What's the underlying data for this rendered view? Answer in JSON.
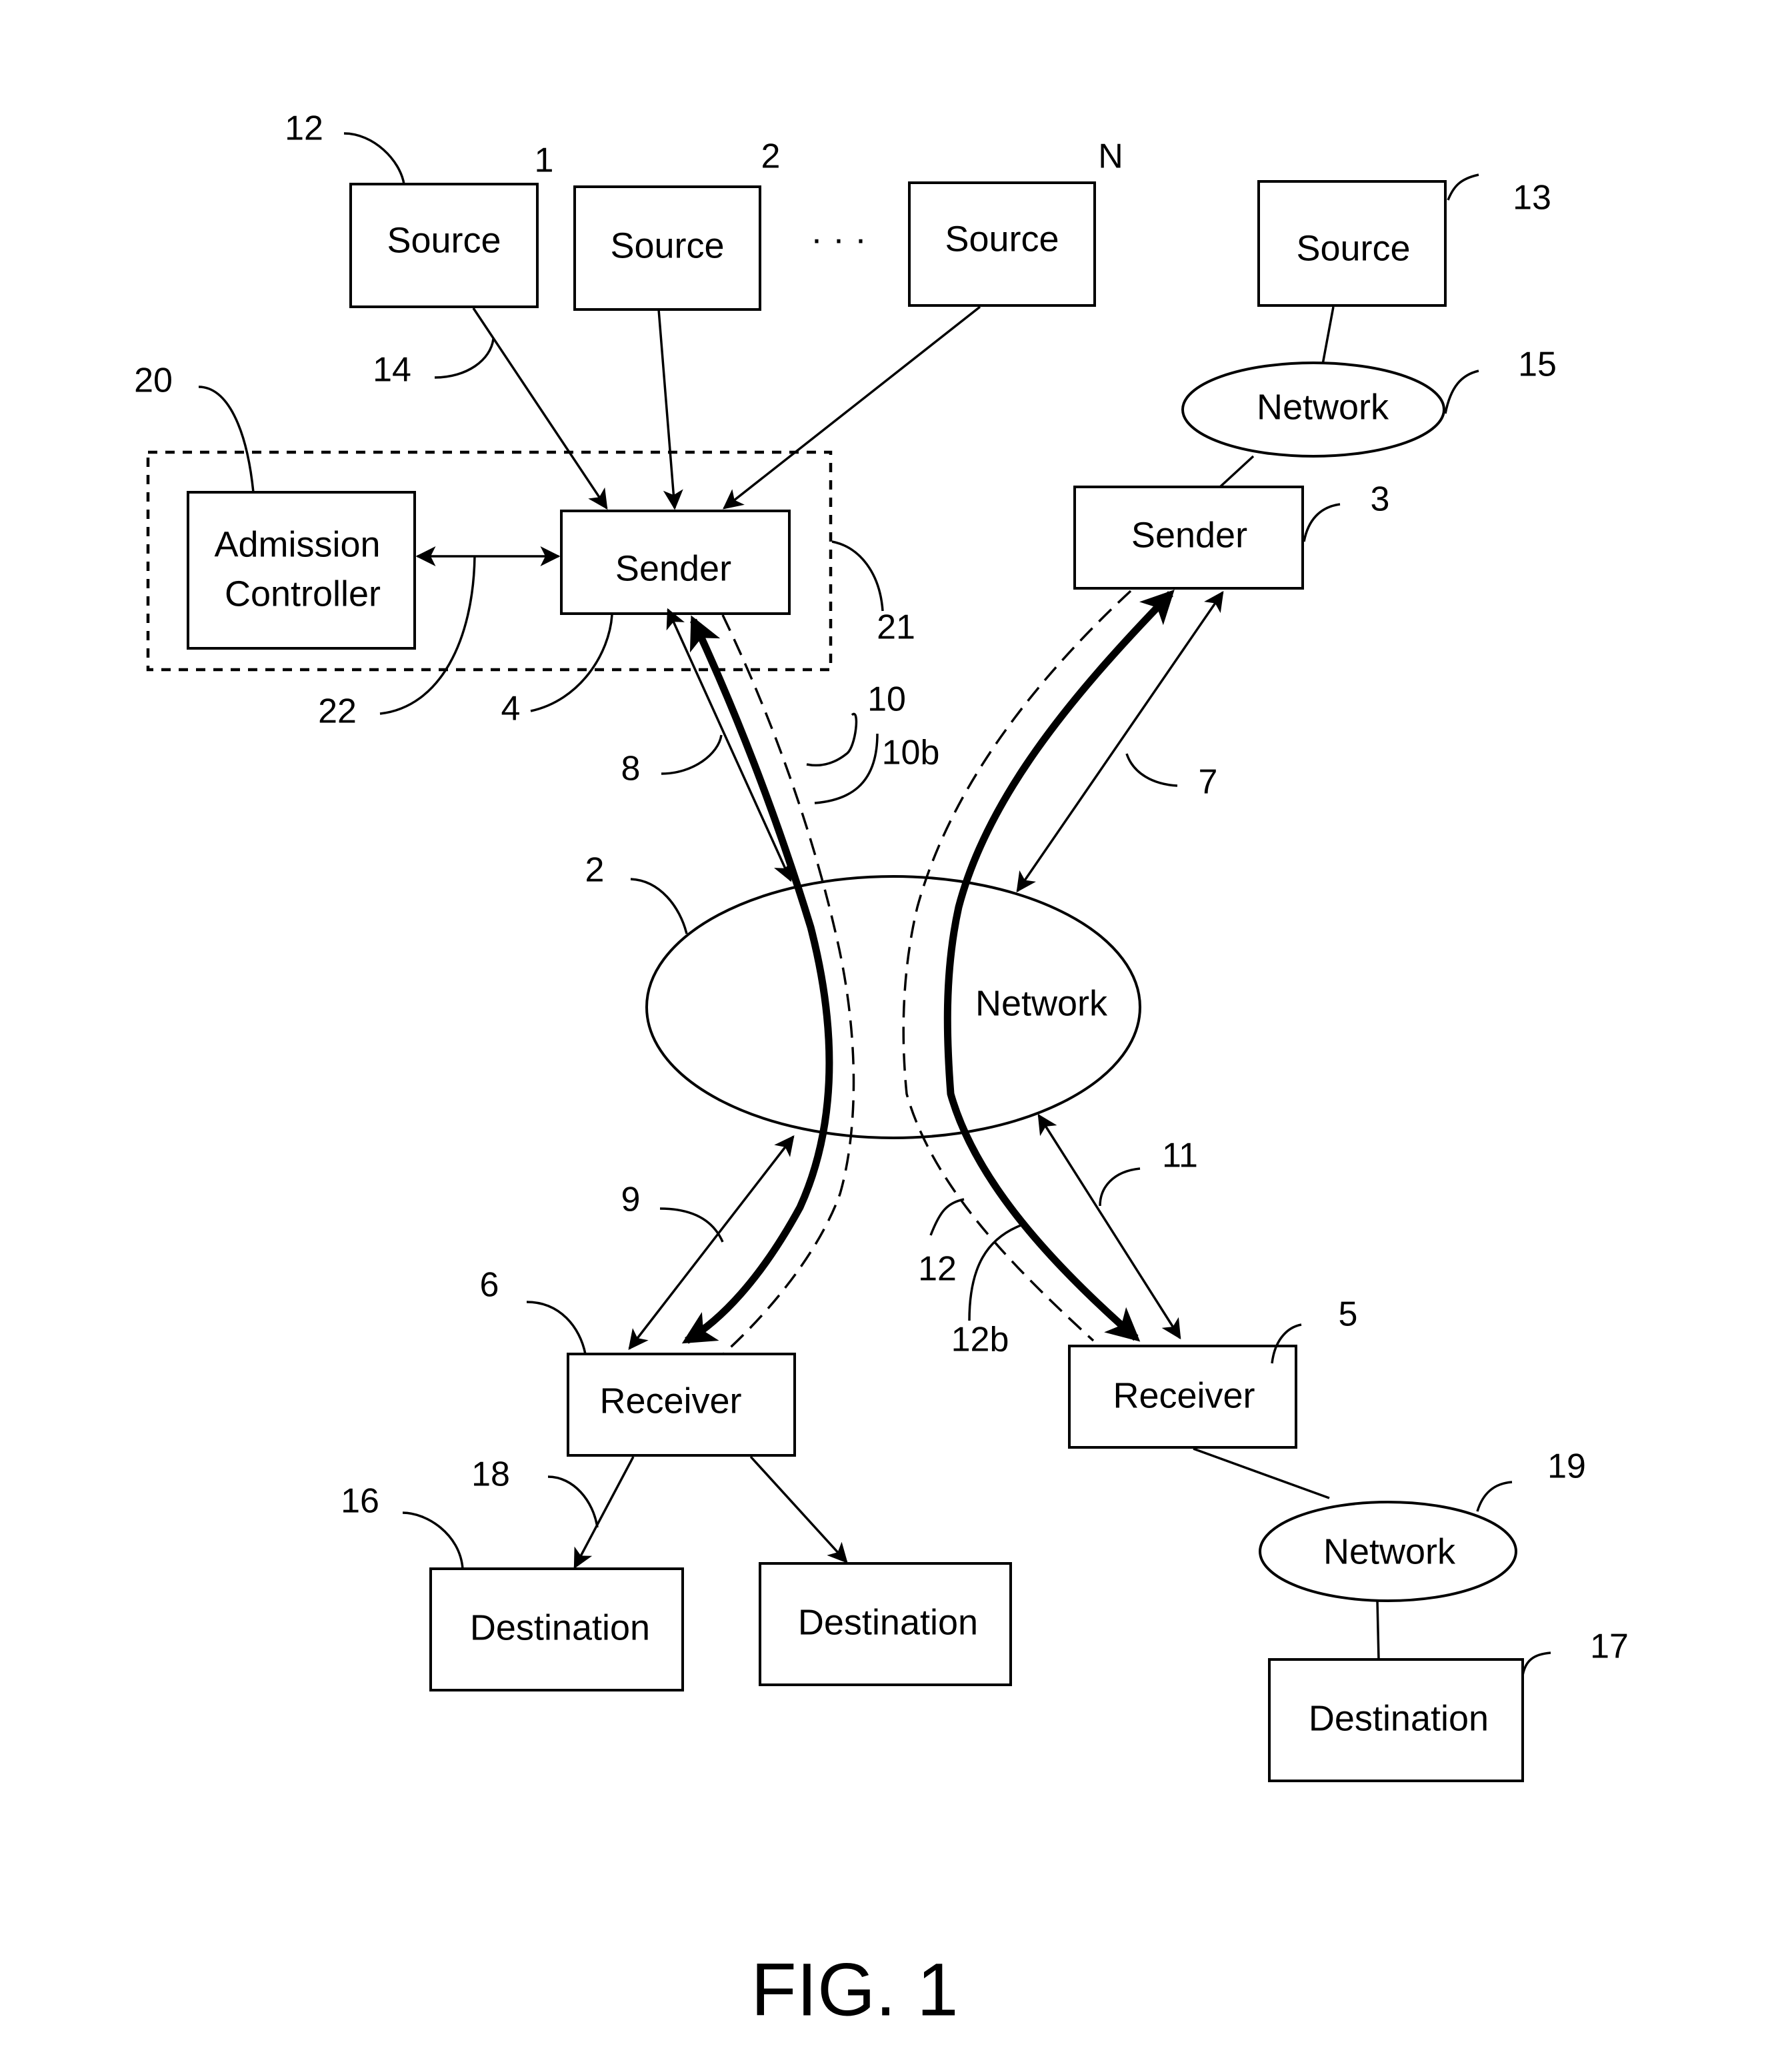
{
  "figure": {
    "caption": "FIG. 1"
  },
  "nodes": {
    "source_1": {
      "label": "Source",
      "index": "1"
    },
    "source_2": {
      "label": "Source",
      "index": "2"
    },
    "source_n": {
      "label": "Source",
      "index": "N"
    },
    "source_ellipsis": "· · ·",
    "source_13": {
      "label": "Source"
    },
    "network_15": {
      "label": "Network"
    },
    "sender_4": {
      "label": "Sender"
    },
    "sender_3": {
      "label": "Sender"
    },
    "admission_controller": {
      "line1": "Admission",
      "line2": "Controller"
    },
    "network_2": {
      "label": "Network"
    },
    "receiver_6": {
      "label": "Receiver"
    },
    "receiver_5": {
      "label": "Receiver"
    },
    "destination_16": {
      "label": "Destination"
    },
    "destination_b": {
      "label": "Destination"
    },
    "network_19": {
      "label": "Network"
    },
    "destination_17": {
      "label": "Destination"
    }
  },
  "reference_numerals": {
    "r12_top": "12",
    "r13": "13",
    "r14": "14",
    "r15": "15",
    "r20": "20",
    "r3": "3",
    "r21": "21",
    "r22": "22",
    "r4": "4",
    "r10": "10",
    "r10b": "10b",
    "r8": "8",
    "r7": "7",
    "r2": "2",
    "r9": "9",
    "r11": "11",
    "r6": "6",
    "r12_bottom": "12",
    "r12b": "12b",
    "r5": "5",
    "r18": "18",
    "r16": "16",
    "r19": "19",
    "r17": "17"
  }
}
